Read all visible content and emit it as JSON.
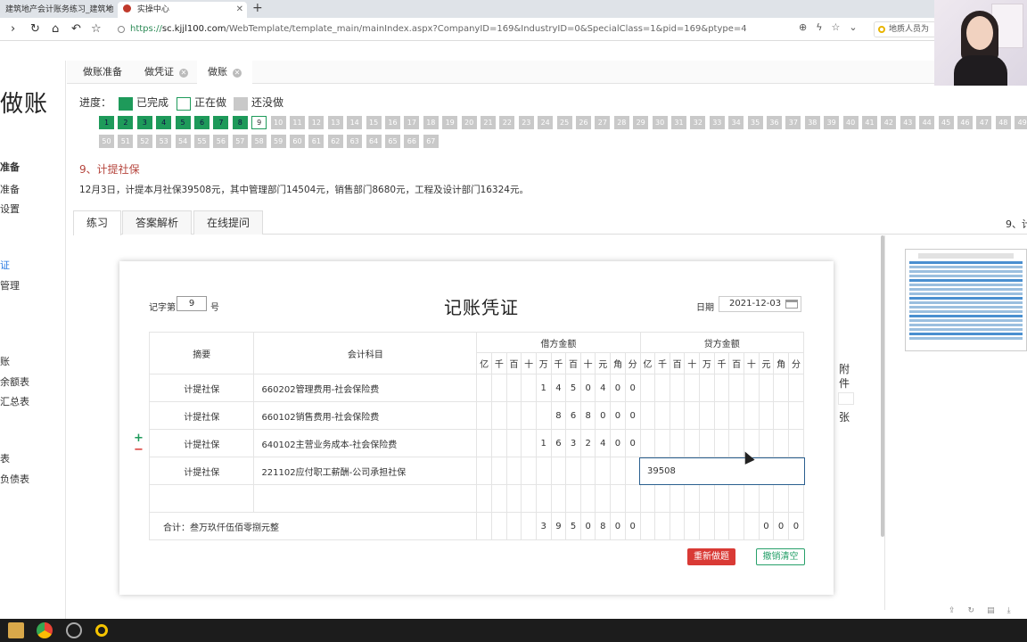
{
  "browser": {
    "tabs": [
      {
        "title": "建筑地产会计账务练习_建筑地",
        "active": false
      },
      {
        "title": "实操中心",
        "active": true
      }
    ],
    "url_https": "https://",
    "url_host": "sc.kjjl100.com",
    "url_path": "/WebTemplate/template_main/mainIndex.aspx?CompanyID=169&IndustryID=0&SpecialClass=1&pid=169&ptype=4",
    "extension_text": "地质人员为"
  },
  "sidebar": {
    "logo": "做账",
    "items": [
      {
        "label": "准备",
        "bold": true
      },
      {
        "label": "准备"
      },
      {
        "label": "设置"
      },
      {
        "label": "证",
        "active": true
      },
      {
        "label": "管理"
      },
      {
        "label": "账"
      },
      {
        "label": "余额表"
      },
      {
        "label": "汇总表"
      },
      {
        "label": "表"
      },
      {
        "label": "负债表"
      }
    ]
  },
  "app_tabs": [
    {
      "label": "做账准备",
      "closable": false
    },
    {
      "label": "做凭证",
      "closable": true
    },
    {
      "label": "做账",
      "closable": true,
      "active": true
    }
  ],
  "progress": {
    "label": "进度：",
    "legend": [
      {
        "label": "已完成",
        "color": "#1e9a5a"
      },
      {
        "label": "正在做",
        "color": "#ffffff"
      },
      {
        "label": "还没做",
        "color": "#c9c9c9"
      }
    ],
    "total": 67,
    "completed": 8,
    "current": 9
  },
  "question": {
    "title": "9、计提社保",
    "description": "12月3日，计提本月社保39508元，其中管理部门14504元，销售部门8680元，工程及设计部门16324元。"
  },
  "sub_tabs": [
    "练习",
    "答案解析",
    "在线提问"
  ],
  "right_panel_title": "9、计",
  "voucher": {
    "word_label": "记字第",
    "number": "9",
    "number_suffix": "号",
    "title": "记账凭证",
    "date_label": "日期",
    "date": "2021-12-03",
    "col_summary": "摘要",
    "col_subject": "会计科目",
    "col_debit": "借方金额",
    "col_credit": "贷方金额",
    "units": [
      "亿",
      "千",
      "百",
      "十",
      "万",
      "千",
      "百",
      "十",
      "元",
      "角",
      "分"
    ],
    "rows": [
      {
        "summary": "计提社保",
        "subject": "660202管理费用-社会保险费",
        "debit": [
          "",
          "",
          "",
          "",
          "1",
          "4",
          "5",
          "0",
          "4",
          "0",
          "0"
        ],
        "credit": [
          "",
          "",
          "",
          "",
          "",
          "",
          "",
          "",
          "",
          "",
          ""
        ]
      },
      {
        "summary": "计提社保",
        "subject": "660102销售费用-社会保险费",
        "debit": [
          "",
          "",
          "",
          "",
          "",
          "8",
          "6",
          "8",
          "0",
          "0",
          "0"
        ],
        "credit": [
          "",
          "",
          "",
          "",
          "",
          "",
          "",
          "",
          "",
          "",
          ""
        ]
      },
      {
        "summary": "计提社保",
        "subject": "640102主营业务成本-社会保险费",
        "debit": [
          "",
          "",
          "",
          "",
          "1",
          "6",
          "3",
          "2",
          "4",
          "0",
          "0"
        ],
        "credit": [
          "",
          "",
          "",
          "",
          "",
          "",
          "",
          "",
          "",
          "",
          ""
        ]
      },
      {
        "summary": "计提社保",
        "subject": "221102应付职工薪酬-公司承担社保",
        "debit": [
          "",
          "",
          "",
          "",
          "",
          "",
          "",
          "",
          "",
          "",
          ""
        ],
        "credit_input": "39508"
      }
    ],
    "total_label": "合计：叁万玖仟伍佰零捌元整",
    "total_debit": [
      "",
      "",
      "",
      "",
      "3",
      "9",
      "5",
      "0",
      "8",
      "0",
      "0"
    ],
    "total_credit": [
      "",
      "",
      "",
      "",
      "",
      "",
      "",
      "",
      "0",
      "0",
      "0"
    ],
    "attachment_label_1": "附",
    "attachment_label_2": "件",
    "attachment_label_3": "张",
    "plus": "+",
    "minus": "−",
    "redo_button": "重新做题",
    "clear_button": "撤销清空"
  }
}
